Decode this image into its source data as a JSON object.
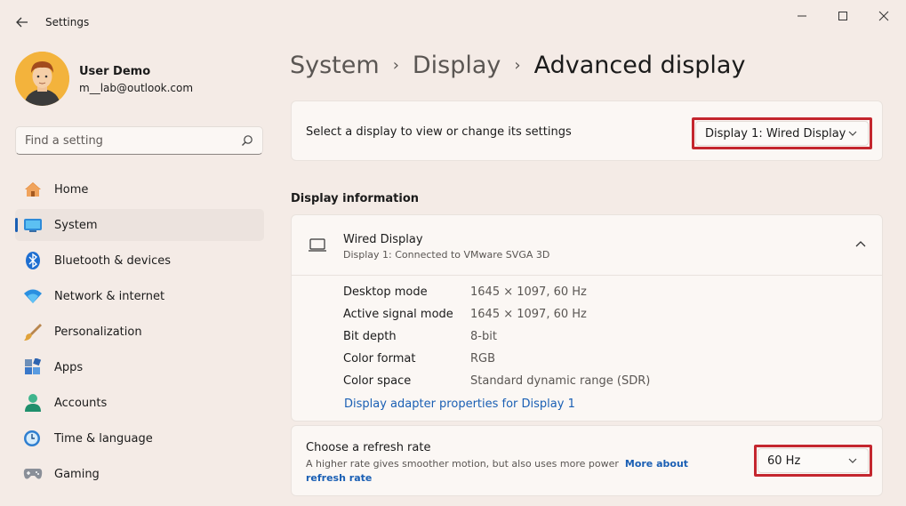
{
  "window": {
    "title": "Settings"
  },
  "user": {
    "name": "User Demo",
    "email": "m__lab@outlook.com"
  },
  "search": {
    "placeholder": "Find a setting"
  },
  "sidebar": {
    "items": [
      {
        "label": "Home",
        "icon": "home-icon"
      },
      {
        "label": "System",
        "icon": "system-icon",
        "active": true
      },
      {
        "label": "Bluetooth & devices",
        "icon": "bluetooth-icon"
      },
      {
        "label": "Network & internet",
        "icon": "wifi-icon"
      },
      {
        "label": "Personalization",
        "icon": "brush-icon"
      },
      {
        "label": "Apps",
        "icon": "apps-icon"
      },
      {
        "label": "Accounts",
        "icon": "accounts-icon"
      },
      {
        "label": "Time & language",
        "icon": "clock-globe-icon"
      },
      {
        "label": "Gaming",
        "icon": "gamepad-icon"
      }
    ]
  },
  "breadcrumb": {
    "items": [
      "System",
      "Display",
      "Advanced display"
    ]
  },
  "display_select": {
    "label": "Select a display to view or change its settings",
    "value": "Display 1: Wired Display"
  },
  "display_info": {
    "section_title": "Display information",
    "name": "Wired Display",
    "subtitle": "Display 1: Connected to VMware SVGA 3D",
    "rows": [
      {
        "key": "Desktop mode",
        "value": "1645 × 1097, 60 Hz"
      },
      {
        "key": "Active signal mode",
        "value": "1645 × 1097, 60 Hz"
      },
      {
        "key": "Bit depth",
        "value": "8-bit"
      },
      {
        "key": "Color format",
        "value": "RGB"
      },
      {
        "key": "Color space",
        "value": "Standard dynamic range (SDR)"
      }
    ],
    "adapter_link": "Display adapter properties for Display 1"
  },
  "refresh_rate": {
    "title": "Choose a refresh rate",
    "description": "A higher rate gives smoother motion, but also uses more power",
    "link": "More about refresh rate",
    "value": "60 Hz"
  },
  "colors": {
    "accent": "#1a5fb4",
    "highlight_outline": "#c4262e",
    "background": "#f4ebe6"
  }
}
